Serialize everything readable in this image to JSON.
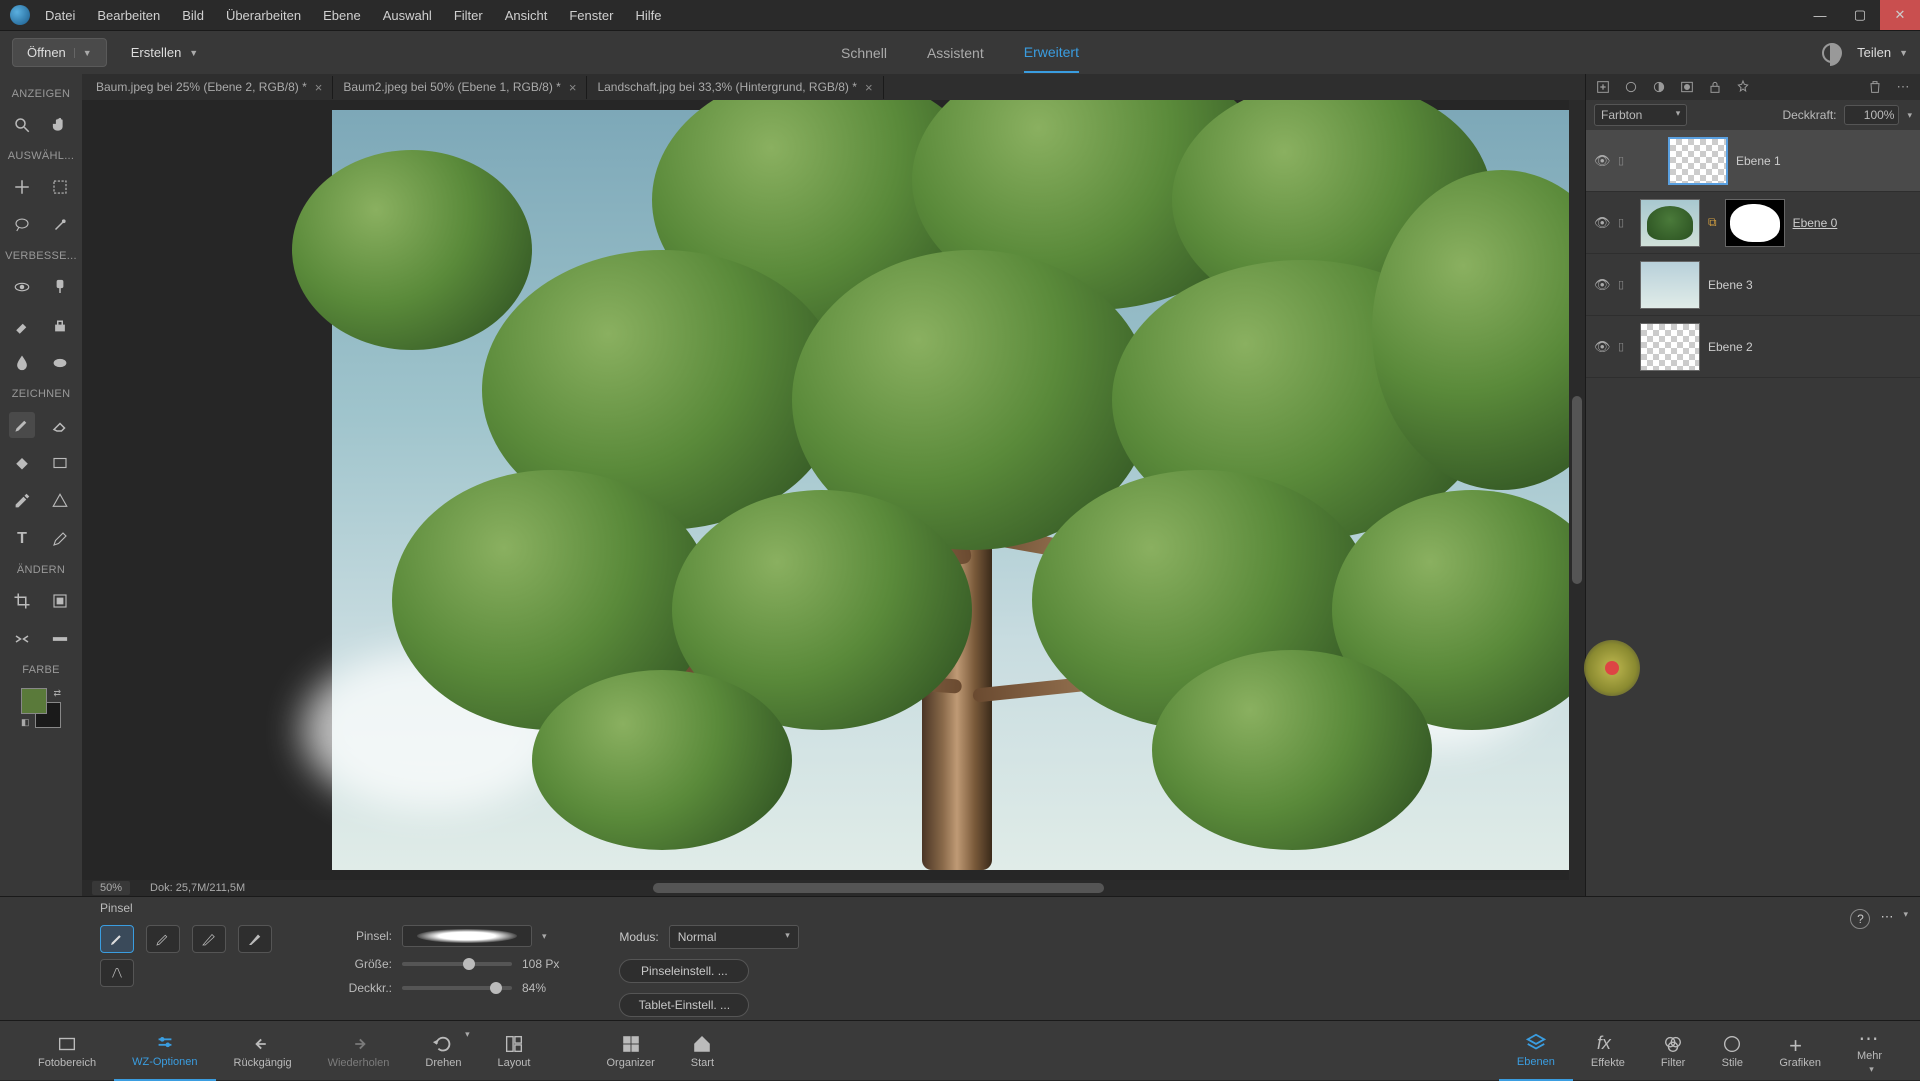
{
  "menu": [
    "Datei",
    "Bearbeiten",
    "Bild",
    "Überarbeiten",
    "Ebene",
    "Auswahl",
    "Filter",
    "Ansicht",
    "Fenster",
    "Hilfe"
  ],
  "toolbar": {
    "open": "Öffnen",
    "create": "Erstellen",
    "share": "Teilen"
  },
  "modes": {
    "quick": "Schnell",
    "guided": "Assistent",
    "expert": "Erweitert"
  },
  "doc_tabs": [
    {
      "label": "Baum.jpeg bei 25% (Ebene 2, RGB/8) *"
    },
    {
      "label": "Baum2.jpeg bei 50% (Ebene 1, RGB/8) *"
    },
    {
      "label": "Landschaft.jpg bei 33,3% (Hintergrund, RGB/8) *"
    }
  ],
  "left_sections": {
    "view": "ANZEIGEN",
    "select": "AUSWÄHL...",
    "enhance": "VERBESSE...",
    "draw": "ZEICHNEN",
    "modify": "ÄNDERN",
    "color": "FARBE"
  },
  "status": {
    "zoom": "50%",
    "doc": "Dok: 25,7M/211,5M"
  },
  "layers_panel": {
    "blend_label": "Farbton",
    "opacity_label": "Deckkraft:",
    "opacity_value": "100%",
    "layers": [
      {
        "name": "Ebene 1"
      },
      {
        "name": "Ebene 0"
      },
      {
        "name": "Ebene 3"
      },
      {
        "name": "Ebene 2"
      }
    ]
  },
  "options": {
    "tool_name": "Pinsel",
    "brush_label": "Pinsel:",
    "size_label": "Größe:",
    "size_value": "108 Px",
    "opacity_label": "Deckkr.:",
    "opacity_value": "84%",
    "mode_label": "Modus:",
    "mode_value": "Normal",
    "brush_settings": "Pinseleinstell. ...",
    "tablet_settings": "Tablet-Einstell. ..."
  },
  "taskbar_left": [
    {
      "label": "Fotobereich"
    },
    {
      "label": "WZ-Optionen"
    },
    {
      "label": "Rückgängig"
    },
    {
      "label": "Wiederholen"
    },
    {
      "label": "Drehen"
    },
    {
      "label": "Layout"
    }
  ],
  "taskbar_center": [
    {
      "label": "Organizer"
    },
    {
      "label": "Start"
    }
  ],
  "taskbar_right": [
    {
      "label": "Ebenen"
    },
    {
      "label": "Effekte"
    },
    {
      "label": "Filter"
    },
    {
      "label": "Stile"
    },
    {
      "label": "Grafiken"
    },
    {
      "label": "Mehr"
    }
  ]
}
